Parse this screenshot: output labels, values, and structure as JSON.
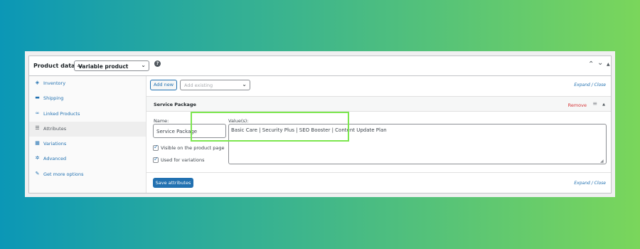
{
  "panel": {
    "title": "Product data —",
    "product_type": "Variable product",
    "help_icon": "question-icon",
    "controls": [
      "collapse-up-icon",
      "expand-down-icon",
      "toggle-icon"
    ]
  },
  "tabs": [
    {
      "label": "Inventory",
      "icon": "inventory-icon",
      "active": false
    },
    {
      "label": "Shipping",
      "icon": "truck-icon",
      "active": false
    },
    {
      "label": "Linked Products",
      "icon": "link-icon",
      "active": false
    },
    {
      "label": "Attributes",
      "icon": "list-icon",
      "active": true
    },
    {
      "label": "Variations",
      "icon": "grid-icon",
      "active": false
    },
    {
      "label": "Advanced",
      "icon": "gear-icon",
      "active": false
    },
    {
      "label": "Get more options",
      "icon": "plugin-icon",
      "active": false
    }
  ],
  "toolbar": {
    "add_new": "Add new",
    "add_existing_placeholder": "Add existing",
    "expand_close": "Expand / Close"
  },
  "attribute": {
    "title": "Service Package",
    "remove": "Remove",
    "name_label": "Name:",
    "name_value": "Service Package",
    "values_label": "Value(s):",
    "values_text": "Basic Care | Security Plus | SEO Booster | Content Update Plan",
    "visible_label": "Visible on the product page",
    "variations_label": "Used for variations",
    "visible_checked": true,
    "variations_checked": true
  },
  "footer": {
    "save": "Save attributes",
    "expand_close": "Expand / Close"
  },
  "colors": {
    "accent": "#2271b1",
    "remove": "#d63638",
    "highlight": "#7ce64f"
  }
}
